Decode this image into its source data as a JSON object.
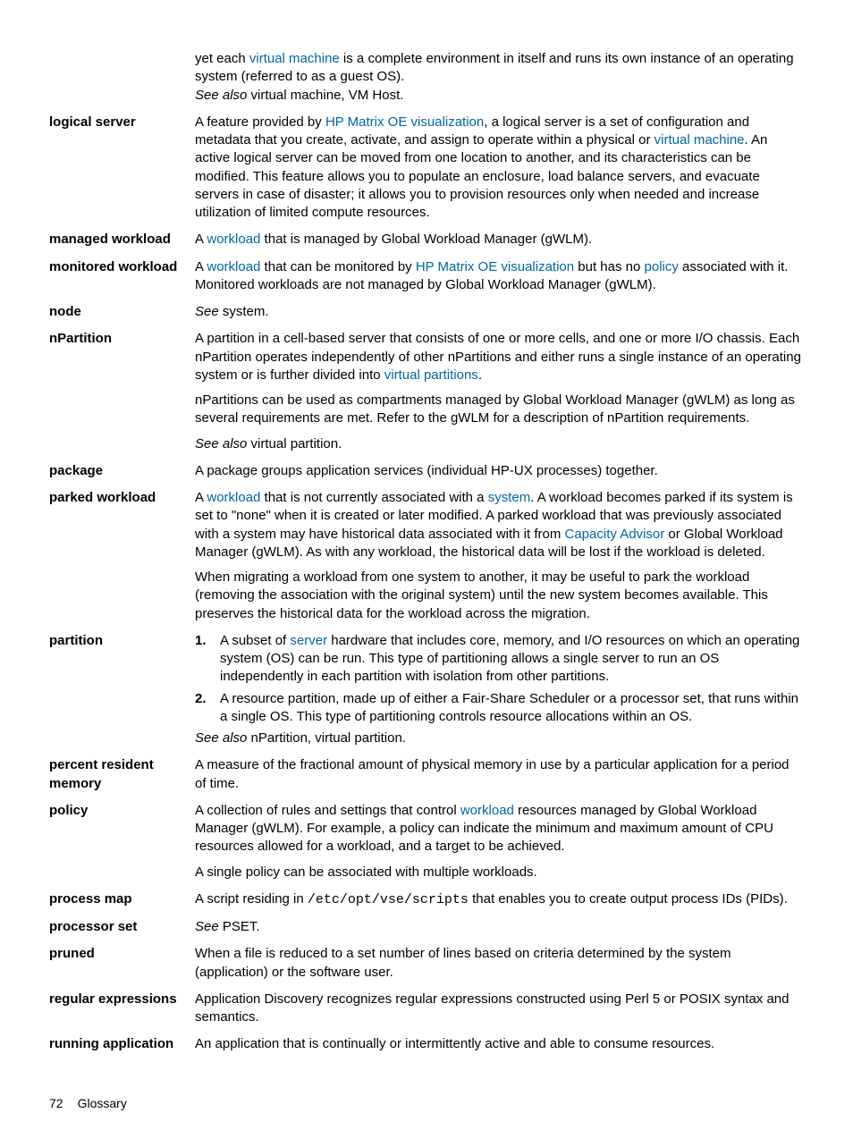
{
  "continuation": {
    "text_before_link": "yet each ",
    "link1": "virtual machine",
    "text_after_link": " is a complete environment in itself and runs its own instance of an operating system (referred to as a guest OS).",
    "see_also_label": "See also",
    "see_also_targets": " virtual machine, VM Host."
  },
  "logical_server": {
    "term": "logical server",
    "p1_a": "A feature provided by ",
    "p1_link1": "HP Matrix OE visualization",
    "p1_b": ", a logical server is a set of configuration and metadata that you create, activate, and assign to operate within a physical or ",
    "p1_link2": "virtual machine",
    "p1_c": ". An active logical server can be moved from one location to another, and its characteristics can be modified. This feature allows you to populate an enclosure, load balance servers, and evacuate servers in case of disaster; it allows you to provision resources only when needed and increase utilization of limited compute resources."
  },
  "managed_workload": {
    "term": "managed workload",
    "a": "A ",
    "link": "workload",
    "b": " that is managed by Global Workload Manager (gWLM)."
  },
  "monitored_workload": {
    "term": "monitored workload",
    "a": "A ",
    "link1": "workload",
    "b": " that can be monitored by ",
    "link2": "HP Matrix OE visualization",
    "c": " but has no ",
    "link3": "policy",
    "d": " associated with it. Monitored workloads are not managed by Global Workload Manager (gWLM)."
  },
  "node": {
    "term": "node",
    "see": "See",
    "target": " system."
  },
  "npartition": {
    "term": "nPartition",
    "p1_a": "A partition in a cell-based server that consists of one or more cells, and one or more I/O chassis. Each nPartition operates independently of other nPartitions and either runs a single instance of an operating system or is further divided into ",
    "p1_link": "virtual partitions",
    "p1_b": ".",
    "p2": "nPartitions can be used as compartments managed by Global Workload Manager (gWLM) as long as several requirements are met. Refer to the gWLM for a description of nPartition requirements.",
    "see_also_label": "See also",
    "see_also_target": " virtual partition."
  },
  "package": {
    "term": "package",
    "def": "A package groups application services (individual HP-UX processes) together."
  },
  "parked_workload": {
    "term": "parked workload",
    "p1_a": "A ",
    "p1_link1": "workload",
    "p1_b": " that is not currently associated with a ",
    "p1_link2": "system",
    "p1_c": ". A workload becomes parked if its system is set to \"none\" when it is created or later modified. A parked workload that was previously associated with a system may have historical data associated with it from ",
    "p1_link3": "Capacity Advisor",
    "p1_d": " or Global Workload Manager (gWLM). As with any workload, the historical data will be lost if the workload is deleted.",
    "p2": "When migrating a workload from one system to another, it may be useful to park the workload (removing the association with the original system) until the new system becomes available. This preserves the historical data for the workload across the migration."
  },
  "partition": {
    "term": "partition",
    "li1_a": "A subset of ",
    "li1_link": "server",
    "li1_b": " hardware that includes core, memory, and I/O resources on which an operating system (OS) can be run. This type of partitioning allows a single server to run an OS independently in each partition with isolation from other partitions.",
    "li2": "A resource partition, made up of either a Fair-Share Scheduler or a processor set, that runs within a single OS. This type of partitioning controls resource allocations within an OS.",
    "see_also_label": "See also",
    "see_also_target": " nPartition, virtual partition."
  },
  "percent_resident_memory": {
    "term": "percent resident memory",
    "def": "A measure of the fractional amount of physical memory in use by a particular application for a period of time."
  },
  "policy": {
    "term": "policy",
    "p1_a": "A collection of rules and settings that control ",
    "p1_link": "workload",
    "p1_b": " resources managed by Global Workload Manager (gWLM). For example, a policy can indicate the minimum and maximum amount of CPU resources allowed for a workload, and a target to be achieved.",
    "p2": "A single policy can be associated with multiple workloads."
  },
  "process_map": {
    "term": "process map",
    "a": "A script residing in ",
    "path": "/etc/opt/vse/scripts",
    "b": " that enables you to create output process IDs (PIDs)."
  },
  "processor_set": {
    "term": "processor set",
    "see": "See",
    "target": " PSET."
  },
  "pruned": {
    "term": "pruned",
    "def": "When a file is reduced to a set number of lines based on criteria determined by the system (application) or the software user."
  },
  "regular_expressions": {
    "term": "regular expressions",
    "def": "Application Discovery recognizes regular expressions constructed using Perl 5 or POSIX syntax and semantics."
  },
  "running_application": {
    "term": "running application",
    "def": "An application that is continually or intermittently active and able to consume resources."
  },
  "footer": {
    "page": "72",
    "section": "Glossary"
  }
}
